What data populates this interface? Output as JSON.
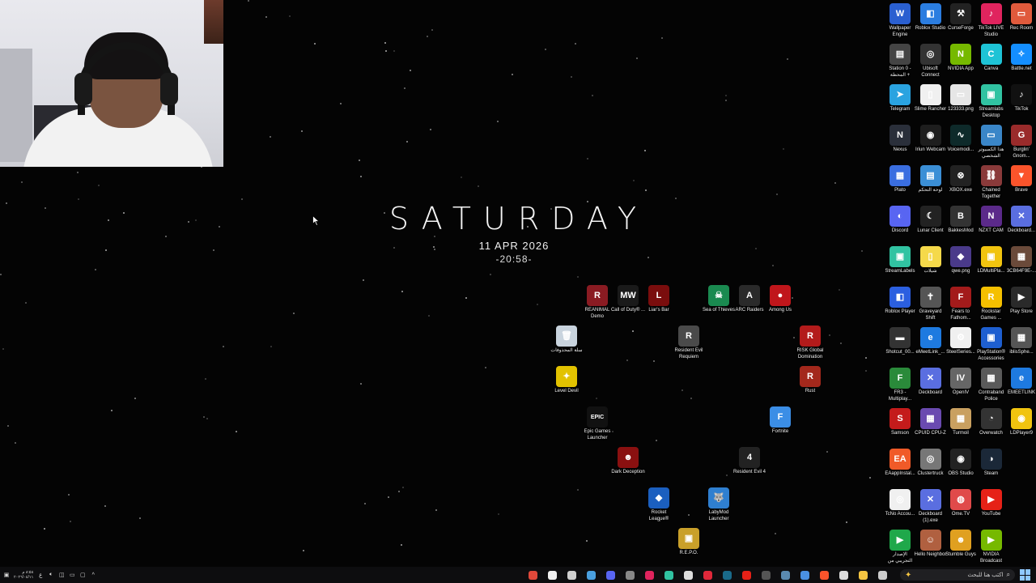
{
  "clock_widget": {
    "day": "SATURDAY",
    "date": "11 APR 2026",
    "time": "-20:58-"
  },
  "desktop_icons": [
    {
      "label": "REANIMAL Demo",
      "color": "#8a1b22",
      "glyph": "R"
    },
    {
      "label": "Call of Duty® ...",
      "color": "#1a1a1a",
      "glyph": "MW"
    },
    {
      "label": "Liar's Bar",
      "color": "#7a0d0d",
      "glyph": "L"
    },
    {
      "label": "Sea of Thieves",
      "color": "#1a8a50",
      "glyph": "☠"
    },
    {
      "label": "ARC Raiders",
      "color": "#2a2a2a",
      "glyph": "A"
    },
    {
      "label": "Among Us",
      "color": "#c0161b",
      "glyph": "●"
    },
    {
      "label": "سلة المحذوفات",
      "color": "#c9d4de",
      "glyph": "🗑"
    },
    {
      "label": "Resident Evil Requiem",
      "color": "#4a4a4a",
      "glyph": "R"
    },
    {
      "label": "RISK Global Domination",
      "color": "#b31b1b",
      "glyph": "R"
    },
    {
      "label": "Level Devil",
      "color": "#e2c200",
      "glyph": "✦"
    },
    {
      "label": "Rust",
      "color": "#a3281c",
      "glyph": "R"
    },
    {
      "label": "Epic Games Launcher",
      "color": "#111111",
      "glyph": "EPIC"
    },
    {
      "label": "Fortnite",
      "color": "#3b8ee6",
      "glyph": "F"
    },
    {
      "label": "Dark Deception",
      "color": "#8a1010",
      "glyph": "☻"
    },
    {
      "label": "Resident Evil 4",
      "color": "#222222",
      "glyph": "4"
    },
    {
      "label": "Rocket League®",
      "color": "#1b5fbf",
      "glyph": "◆"
    },
    {
      "label": "LabyMod Launcher",
      "color": "#2f7fd0",
      "glyph": "🐺"
    },
    {
      "label": "R.E.P.O.",
      "color": "#c9a02a",
      "glyph": "▣"
    }
  ],
  "right_icons": [
    {
      "label": "Wallpaper Engine",
      "color": "#2a5fd0",
      "glyph": "W"
    },
    {
      "label": "Roblox Studio",
      "color": "#2b7de0",
      "glyph": "◧"
    },
    {
      "label": "CurseForge",
      "color": "#222222",
      "glyph": "⚒"
    },
    {
      "label": "TikTok LIVE Studio",
      "color": "#e0245e",
      "glyph": "♪"
    },
    {
      "label": "Rec Room",
      "color": "#e05a3c",
      "glyph": "▭"
    },
    {
      "label": "Station 0 - المحطة +",
      "color": "#444444",
      "glyph": "▤"
    },
    {
      "label": "Ubisoft Connect",
      "color": "#333333",
      "glyph": "◎"
    },
    {
      "label": "NVIDIA App",
      "color": "#76b900",
      "glyph": "N"
    },
    {
      "label": "Canva",
      "color": "#1ec3d6",
      "glyph": "C"
    },
    {
      "label": "Battle.net",
      "color": "#148eff",
      "glyph": "✧"
    },
    {
      "label": "Telegram",
      "color": "#2aa3e0",
      "glyph": "➤"
    },
    {
      "label": "Slime Rancher",
      "color": "#f0f0f0",
      "glyph": "▯"
    },
    {
      "label": "123333.png",
      "color": "#e6e6e6",
      "glyph": "▭"
    },
    {
      "label": "Streamlabs Desktop",
      "color": "#31c3a2",
      "glyph": "▣"
    },
    {
      "label": "TikTok",
      "color": "#111111",
      "glyph": "♪"
    },
    {
      "label": "Nexus",
      "color": "#2a2f3a",
      "glyph": "N"
    },
    {
      "label": "Iriun Webcam",
      "color": "#1e1e1e",
      "glyph": "◉"
    },
    {
      "label": "Voicemodi...",
      "color": "#0e2a2a",
      "glyph": "∿"
    },
    {
      "label": "هذا الكمبيوتر الشخصي",
      "color": "#3a86c8",
      "glyph": "▭"
    },
    {
      "label": "Burglin' Gnom...",
      "color": "#9a2b2b",
      "glyph": "G"
    },
    {
      "label": "Plato",
      "color": "#3a6ee0",
      "glyph": "▦"
    },
    {
      "label": "لوحة التحكم",
      "color": "#3b8fd6",
      "glyph": "▤"
    },
    {
      "label": "XBOX.exe",
      "color": "#222222",
      "glyph": "⊗"
    },
    {
      "label": "Chained Together",
      "color": "#8a3a3a",
      "glyph": "⛓"
    },
    {
      "label": "Brave",
      "color": "#fb542b",
      "glyph": "▼"
    },
    {
      "label": "Discord",
      "color": "#5865f2",
      "glyph": "◐"
    },
    {
      "label": "Lunar Client",
      "color": "#222222",
      "glyph": "☾"
    },
    {
      "label": "BakkesMod",
      "color": "#333333",
      "glyph": "B"
    },
    {
      "label": "NZXT CAM",
      "color": "#5b2a8a",
      "glyph": "N"
    },
    {
      "label": "Deckboard...",
      "color": "#5a6ee0",
      "glyph": "✕"
    },
    {
      "label": "StreamLabels",
      "color": "#31c3a2",
      "glyph": "▣"
    },
    {
      "label": "شيلات",
      "color": "#f5d94a",
      "glyph": "▯"
    },
    {
      "label": "qwe.png",
      "color": "#4a3a8a",
      "glyph": "◆"
    },
    {
      "label": "LDMultiPla...",
      "color": "#f1c40f",
      "glyph": "▣"
    },
    {
      "label": "3CB64F9E-...",
      "color": "#6a4a3a",
      "glyph": "▦"
    },
    {
      "label": "Roblox Player",
      "color": "#2b5fe0",
      "glyph": "◧"
    },
    {
      "label": "Graveyard Shift",
      "color": "#555555",
      "glyph": "✝"
    },
    {
      "label": "Fears to Fathom...",
      "color": "#a31b1b",
      "glyph": "F"
    },
    {
      "label": "Rockstar Games ...",
      "color": "#f5c000",
      "glyph": "R"
    },
    {
      "label": "Play Store",
      "color": "#2a2a2a",
      "glyph": "▶"
    },
    {
      "label": "Shotcut_00...",
      "color": "#333333",
      "glyph": "▬"
    },
    {
      "label": "eMeetLink_...",
      "color": "#1e7ae0",
      "glyph": "e"
    },
    {
      "label": "SteelSeries...",
      "color": "#f0f0f0",
      "glyph": "⚙"
    },
    {
      "label": "PlayStation® Accessories",
      "color": "#1e5fd0",
      "glyph": "▣"
    },
    {
      "label": "iblisSphe...",
      "color": "#555555",
      "glyph": "▦"
    },
    {
      "label": "FR3 - Multiplay...",
      "color": "#2a8a3a",
      "glyph": "F"
    },
    {
      "label": "Deckboard",
      "color": "#5a6ee0",
      "glyph": "✕"
    },
    {
      "label": "OpenIV",
      "color": "#666666",
      "glyph": "IV"
    },
    {
      "label": "Contraband Police",
      "color": "#5a5a5a",
      "glyph": "▦"
    },
    {
      "label": "EMEETLINK",
      "color": "#1e7ae0",
      "glyph": "e"
    },
    {
      "label": "Samson",
      "color": "#c41b1b",
      "glyph": "S"
    },
    {
      "label": "CPUID CPU-Z",
      "color": "#6a4ab0",
      "glyph": "▦"
    },
    {
      "label": "Turmoil",
      "color": "#c9a060",
      "glyph": "▦"
    },
    {
      "label": "Overwatch",
      "color": "#333333",
      "glyph": "◔"
    },
    {
      "label": "LDPlayer9",
      "color": "#f1c40f",
      "glyph": "◉"
    },
    {
      "label": "EAappInstal...",
      "color": "#f05a28",
      "glyph": "EA"
    },
    {
      "label": "Clustertruck",
      "color": "#777777",
      "glyph": "◎"
    },
    {
      "label": "OBS Studio",
      "color": "#222222",
      "glyph": "◉"
    },
    {
      "label": "Steam",
      "color": "#1b2838",
      "glyph": "◑"
    },
    {
      "label": "",
      "color": "",
      "glyph": ""
    },
    {
      "label": "TcNo Accou...",
      "color": "#f0f0f0",
      "glyph": "◎"
    },
    {
      "label": "Deckboard (1).exe",
      "color": "#5a6ee0",
      "glyph": "✕"
    },
    {
      "label": "Ome.TV",
      "color": "#e04a4a",
      "glyph": "◍"
    },
    {
      "label": "YouTube",
      "color": "#e62117",
      "glyph": "▶"
    },
    {
      "label": "",
      "color": "",
      "glyph": ""
    },
    {
      "label": "الإصدار التجريبي من",
      "color": "#1fa84a",
      "glyph": "▶"
    },
    {
      "label": "Hello Neighbor",
      "color": "#b06040",
      "glyph": "☺"
    },
    {
      "label": "Stumble Guys",
      "color": "#e0a020",
      "glyph": "☻"
    },
    {
      "label": "NVIDIA Broadcast",
      "color": "#76b900",
      "glyph": "▶"
    },
    {
      "label": "",
      "color": "",
      "glyph": ""
    }
  ],
  "taskbar": {
    "clock_time": "٨:٥٨ م",
    "clock_date": "٢٠٢٦/٠٤/١١",
    "search_placeholder": "اكتب هنا للبحث",
    "apps": [
      {
        "name": "chrome",
        "color": "#e0483a"
      },
      {
        "name": "search-app",
        "color": "#f0f0f0"
      },
      {
        "name": "xbox",
        "color": "#cfcfcf"
      },
      {
        "name": "wolf",
        "color": "#4aa0e0"
      },
      {
        "name": "discord",
        "color": "#5865f2"
      },
      {
        "name": "github",
        "color": "#888888"
      },
      {
        "name": "tiktok-live",
        "color": "#e0245e"
      },
      {
        "name": "streamlabs",
        "color": "#31c3a2"
      },
      {
        "name": "capcut",
        "color": "#dddddd"
      },
      {
        "name": "adobe",
        "color": "#e0283a"
      },
      {
        "name": "terminal",
        "color": "#1a6a8a"
      },
      {
        "name": "youtube",
        "color": "#e62117"
      },
      {
        "name": "calculator",
        "color": "#555555"
      },
      {
        "name": "steam",
        "color": "#5a8ab0"
      },
      {
        "name": "chrome-2",
        "color": "#4a90e2"
      },
      {
        "name": "brave",
        "color": "#fb542b"
      },
      {
        "name": "tiktok",
        "color": "#dddddd"
      },
      {
        "name": "file-explorer",
        "color": "#f5c542"
      },
      {
        "name": "task-view",
        "color": "#cccccc"
      }
    ]
  }
}
